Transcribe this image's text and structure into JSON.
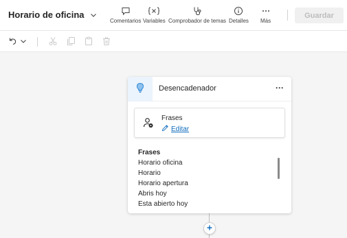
{
  "header": {
    "topic_title": "Horario de oficina",
    "commands": [
      {
        "label": "Comentarios",
        "icon": "comment-icon"
      },
      {
        "label": "Variables",
        "icon": "variables-icon"
      },
      {
        "label": "Comprobador de temas",
        "icon": "stethoscope-icon"
      },
      {
        "label": "Detalles",
        "icon": "info-icon"
      },
      {
        "label": "Más",
        "icon": "more-icon"
      }
    ],
    "save_label": "Guardar"
  },
  "toolbar": {
    "items": [
      "undo-icon",
      "chevron-down-icon",
      "cut-icon",
      "copy-icon",
      "paste-icon",
      "delete-icon"
    ]
  },
  "trigger_card": {
    "title": "Desencadenador",
    "more_label": "···",
    "phrases_box": {
      "label": "Frases",
      "edit_label": "Editar"
    },
    "phrases_list": {
      "header": "Frases",
      "items": [
        "Horario oficina",
        "Horario",
        "Horario apertura",
        "Abris hoy",
        "Esta abierto hoy"
      ]
    }
  },
  "canvas": {
    "add_node_label": "+"
  },
  "colors": {
    "accent": "#0f6cbd",
    "trigger_icon": "#2b88d8",
    "canvas_bg": "#f5f5f5"
  }
}
